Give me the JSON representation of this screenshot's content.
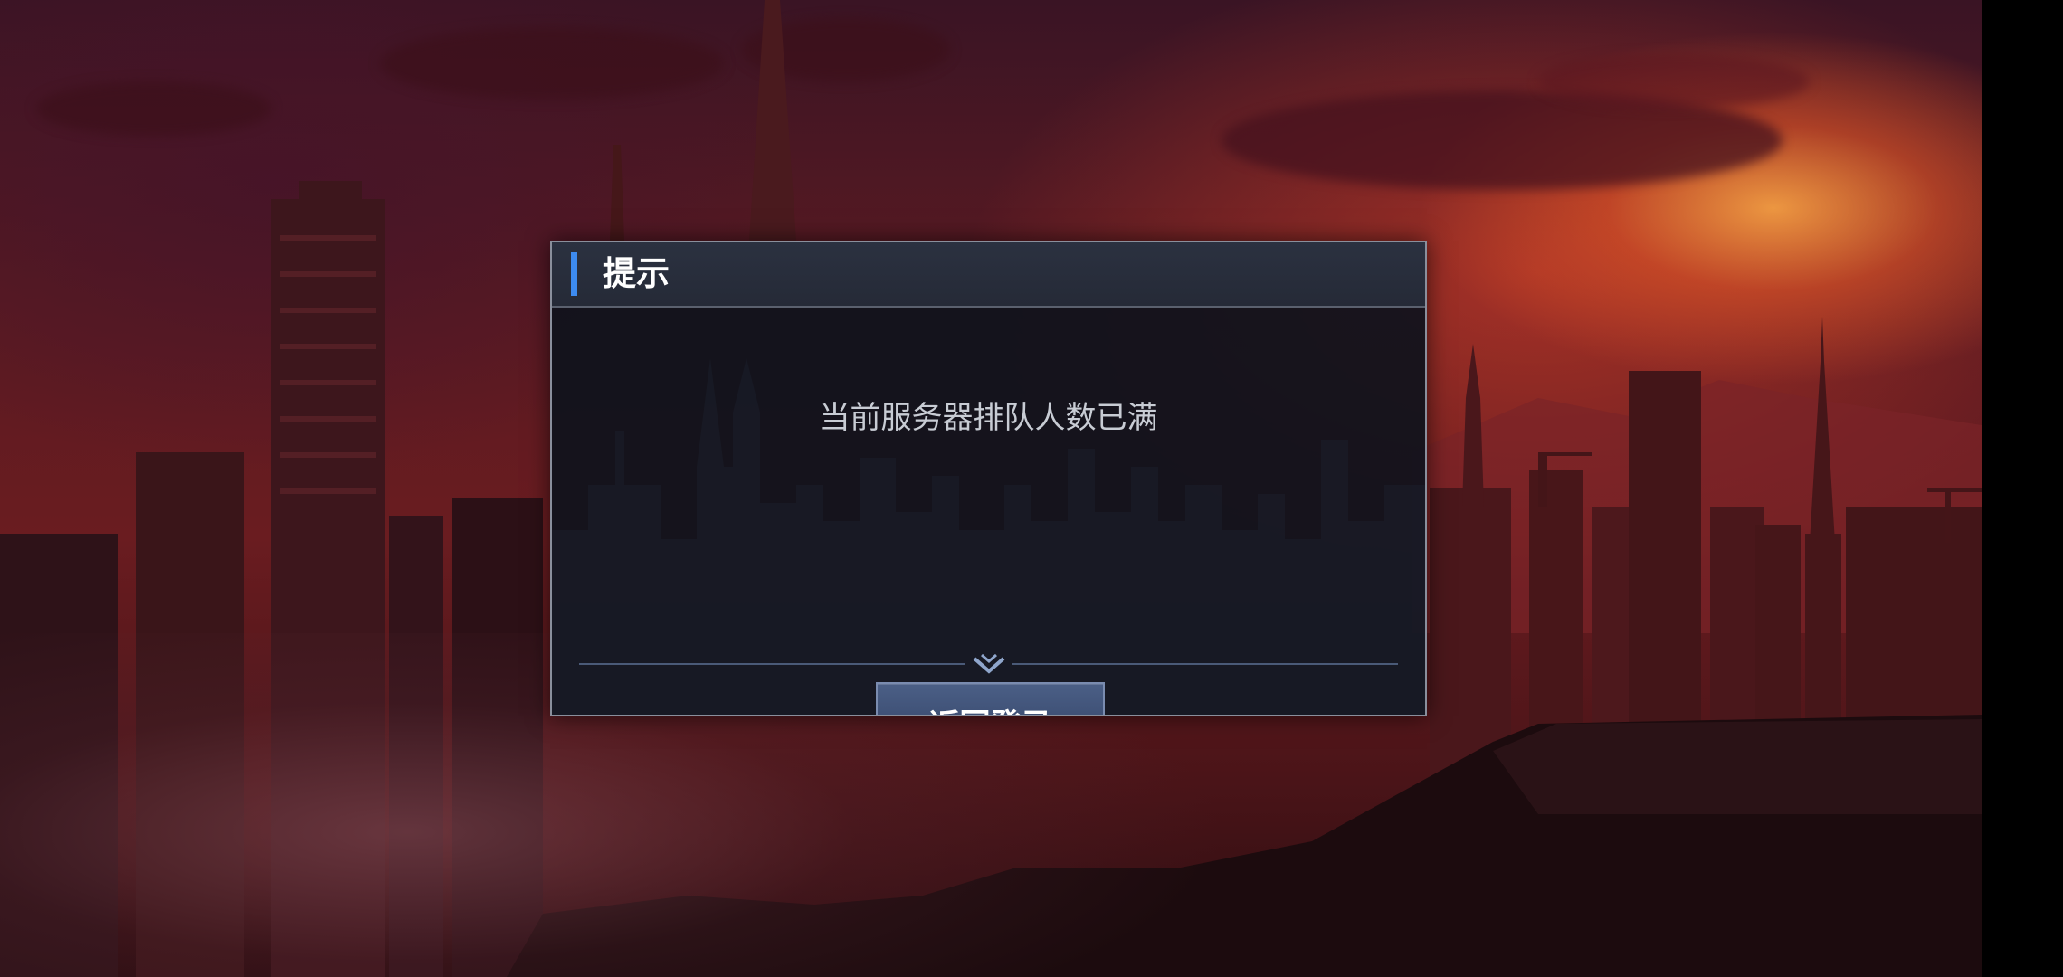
{
  "dialog": {
    "title": "提示",
    "message": "当前服务器排队人数已满",
    "button_label": "返回登录"
  },
  "colors": {
    "accent": "#3d8bf0",
    "button": "#3b4d72",
    "sky": "#6a1c20"
  },
  "icons": {
    "divider": "chevron-down-icon"
  }
}
